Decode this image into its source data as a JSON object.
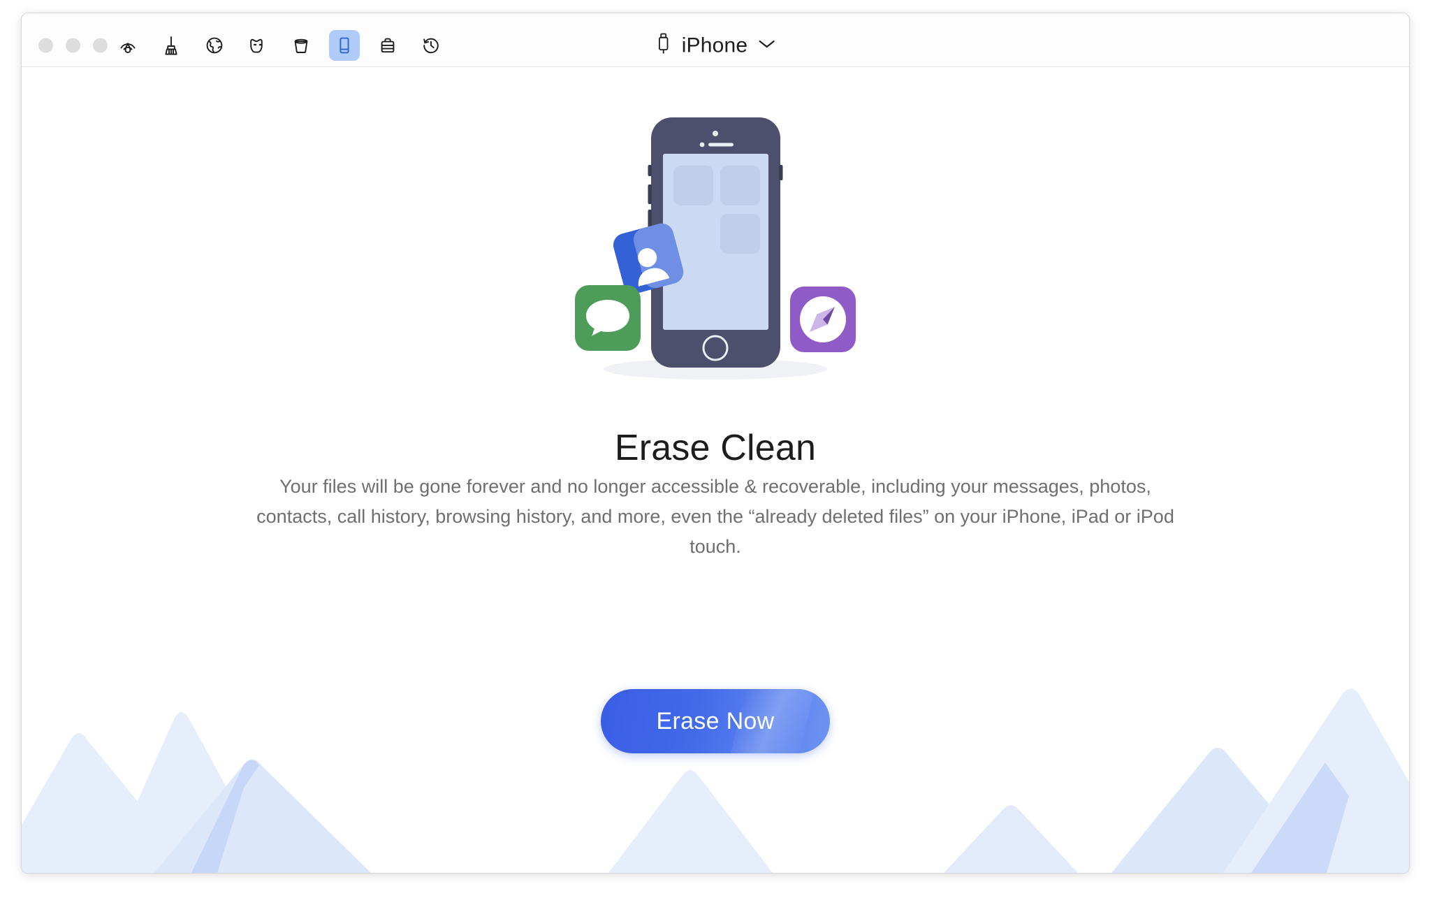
{
  "window": {
    "traffic_lights": [
      {
        "name": "close",
        "color": "#dddddd"
      },
      {
        "name": "minimize",
        "color": "#dddddd"
      },
      {
        "name": "zoom",
        "color": "#dddddd"
      }
    ]
  },
  "toolbar": {
    "items": [
      {
        "icon": "radar-scan-icon",
        "label": "Scan",
        "selected": false
      },
      {
        "icon": "broom-clean-icon",
        "label": "Clean",
        "selected": false
      },
      {
        "icon": "globe-browser-icon",
        "label": "Browser",
        "selected": false
      },
      {
        "icon": "mask-privacy-icon",
        "label": "Privacy",
        "selected": false
      },
      {
        "icon": "trash-bin-icon",
        "label": "Trash",
        "selected": false
      },
      {
        "icon": "device-phone-icon",
        "label": "Erase Clean",
        "selected": true
      },
      {
        "icon": "toolbox-icon",
        "label": "Toolbox",
        "selected": false
      },
      {
        "icon": "clock-history-icon",
        "label": "History",
        "selected": false
      }
    ]
  },
  "device_selector": {
    "icon": "lightning-connector-icon",
    "label": "iPhone",
    "chevron": "chevron-down-icon"
  },
  "illustration": {
    "name": "iphone-with-app-icons-illustration",
    "app_icons": [
      {
        "name": "contacts-app-icon",
        "color": "#3561d6"
      },
      {
        "name": "messages-app-icon",
        "color": "#4e9c5a"
      },
      {
        "name": "safari-app-icon",
        "color": "#8e5bc7"
      }
    ],
    "device_body_color": "#4d4f6c",
    "device_screen_color": "#ccd9f2"
  },
  "main": {
    "headline": "Erase Clean",
    "description": "Your files will be gone forever and no longer accessible & recoverable, including your messages, photos, contacts, call history, browsing history, and more, even the “already deleted files” on your iPhone, iPad or iPod touch.",
    "cta_label": "Erase Now"
  },
  "colors": {
    "accent": "#4169e8",
    "selected_tool_background": "#aecbfa",
    "mountain_light": "#e7eefb",
    "mountain_mid": "#dbe6f9",
    "mountain_overlap": "#c3d4f7",
    "text_primary": "#1d1d1f",
    "text_secondary": "#6e6e73"
  }
}
